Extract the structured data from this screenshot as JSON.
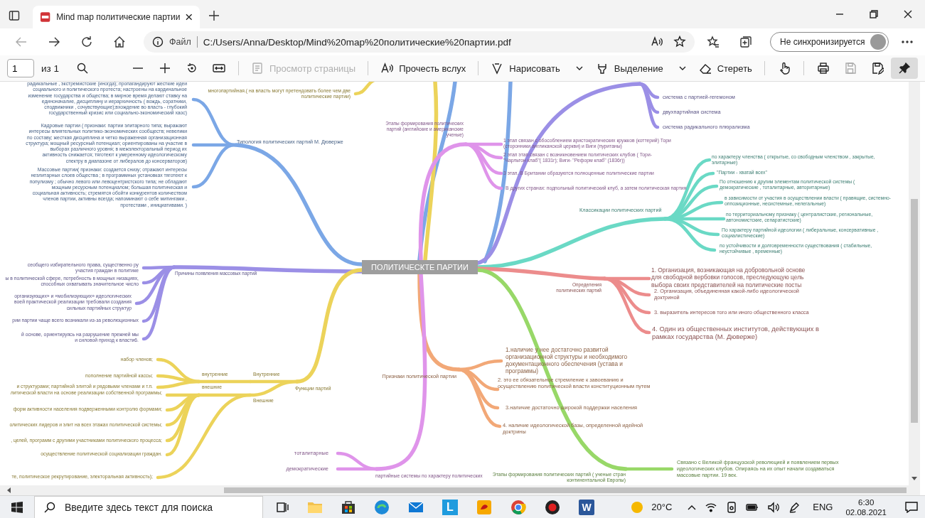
{
  "browser": {
    "tab": {
      "title": "Mind map политические партии",
      "selected": true
    },
    "address": {
      "scheme": "Файл",
      "url": "C:/Users/Anna/Desktop/Mind%20map%20политические%20партии.pdf"
    },
    "sync_button": "Не синхронизируется"
  },
  "pdf_toolbar": {
    "page": "1",
    "page_count": "из 1",
    "items": [
      {
        "label": "Просмотр страницы",
        "dropdown": false,
        "disabled": true
      },
      {
        "label": "Прочесть вслух",
        "dropdown": false,
        "disabled": false
      },
      {
        "label": "Нарисовать",
        "dropdown": true,
        "disabled": false
      },
      {
        "label": "Выделение",
        "dropdown": true,
        "disabled": false
      },
      {
        "label": "Стереть",
        "dropdown": false,
        "disabled": false
      }
    ],
    "pin": {
      "selected": true
    }
  },
  "mindmap": {
    "center": "ПОЛИТИЧЕСКТЕ ПАРТИИ",
    "branches": [
      {
        "label": "Типология политических партий М. Дюверже",
        "color": "#7ba7e6",
        "children": [
          {
            "text": "радикальные , экстремистские (иногда); пропагандируют жесткие идеи социального и политического протеста; настроены на кардинальное изменение государства и общества; в мирное время делают ставку на единоначалие, дисциплину и иерархичность ( вождь, соратники, сподвижники , сочувствующие);вхождение во власть - глубокий государственный кризис или социально-экономический хаос)"
          },
          {
            "text": "Кадровые партии ( признаки: партии элитарного типа; выражают интересы влиятельных политико-экономических сообществ; невелики по составу; жесткая дисциплина и четко выраженная организационная структура; мощный ресурсный потенциал; ориентированы на участие в выборах различного уровня; в межэлекторальный период их активность снижается; тяготеют к умеренному идеологическому спектру в диапазоне от либералов до консерваторов)"
          },
          {
            "text": "Массовые партии( признаки: создается снизу; отражают интересы неэлитарных слоев общества ; в программных установках тяготеют к популизму ; обычно левого или левоцентристского типа; не обладают мощным ресурсным потенциалом; большая политическая и социальная активность; стремятся обойти конкурентов количеством членов партии, активны всегда; напоминают о себе митингами , протестами , инициативами. )"
          }
        ]
      },
      {
        "color": "#ecd35a",
        "children": [
          {
            "text": "многопартийная.( на власть могут претендовать более чем две политические партии)"
          }
        ]
      },
      {
        "label": "Этапы формирования политических партий (английские и американские ученые)",
        "color": "#df94ea",
        "children": [
          {
            "text": "1 этап связан с обособлением аристократических кружков (коттерий) Тори (сторонники англиканской церкви) и Виги (пуританы)"
          },
          {
            "text": "2 этап этап связан с возникновением политических клубов ( Тори-\"Чарльтон клаб\"( 1831г); Виги- \"Реформ клаб\" (1836г))"
          },
          {
            "text": "3 этап. В Британии образуются полноценные политические партии"
          },
          {
            "text": "В других странах: подпольный политический клуб, а затем политическая партия"
          }
        ]
      },
      {
        "color": "#9b8fe6",
        "children": [
          {
            "text": "система с партией-гегемоном"
          },
          {
            "text": "двухпартийная система"
          },
          {
            "text": "система радикального плюрализма"
          }
        ]
      },
      {
        "label": "Классикации политических партий",
        "color": "#6ad9c5",
        "children": [
          {
            "text": "по характеру членства ( открытые, со свободным членством , закрытые, элитарные)"
          },
          {
            "text": "\"Партии - хватай всех\""
          },
          {
            "text": "По отношению к другим элементам политической системы ( демократические , тоталитарные, авторитарные)"
          },
          {
            "text": "в зависимости от участия в осуществлении власти ( правящие, системно-оппозиционные, несистемные, нелегальные)"
          },
          {
            "text": "по территориальному признаку ( централистские, региональные, автономистские, сепаратистские)"
          },
          {
            "text": "По характеру партийной идеологии ( либеральные, консервативные , социалистические)"
          },
          {
            "text": "по устойчивости и долговременности существования ( стабильные, неустойчивые , временные)"
          }
        ]
      },
      {
        "label": "Определения политических партий",
        "color": "#ec8c8c",
        "children": [
          {
            "text": "1.  Организация, возникающая на добровольной основе для свободной вербовки голосов, преследующую цель выбора своих представителей на политические посты"
          },
          {
            "text": "2.  Организация, объединенная какой-либо идеологической доктриной"
          },
          {
            "text": "3.  выразитель интересов того или иного общественного класса"
          },
          {
            "text": "4.  Один из общественных институтов, действующих в рамках государства (М. Дюверже)"
          }
        ]
      },
      {
        "label": "Этапы формирования политических партий ( ученые стран континентальной Европы)",
        "color": "#98d868",
        "children": [
          {
            "text": "Связано с Великой французской революцией и появлением первых идеологических клубов. Опираясь на их опыт начали создаваться массовые партии. 19 век."
          }
        ]
      },
      {
        "label": "Признаки политической партии",
        "color": "#f2a877",
        "children": [
          {
            "text": "1.наличие у нее достаточно развитой организационной структуры и необходимого документационного обеспечения (устава и программы)"
          },
          {
            "text": "2.  это ее обязательное стремление к завоеванию и осуществлению политической власти конституционным путем"
          },
          {
            "text": "3.наличие достаточно широкой поддержки населения"
          },
          {
            "text": "4.  наличие идеологической базы, определенной идейной доктрины"
          }
        ]
      },
      {
        "label": "Причины появления массовых партий",
        "color": "#9b8fe6",
        "children": [
          {
            "text": "сеобщего избирательного права, существенно ру участия граждан в политике"
          },
          {
            "text": "ы в политической сфере, потребность в мощных низациях, способных охватывать значительное число"
          },
          {
            "text": "организующих» и «мобилизующих» идеологических воей практической реализации требовали создания сильных партийных структур"
          },
          {
            "text": "рии партии чаще всего возникали из-за революционных"
          },
          {
            "text": "й основе, ориентируясь на разрушение прежней мы и силовой приход к власти6."
          }
        ]
      },
      {
        "label": "Функции партий",
        "color": "#ecd35a",
        "children": [
          {
            "text": "Внутренние",
            "children": [
              {
                "text": "внутренние",
                "children": [
                  {
                    "text": "набор членов;"
                  },
                  {
                    "text": "пополнение партийной кассы;"
                  },
                  {
                    "text": "и структурами; партийной элитой и рядовыми членами и т.п."
                  }
                ]
              }
            ]
          },
          {
            "text": "Внешние",
            "children": [
              {
                "text": "внешние",
                "children": [
                  {
                    "text": "литической власти на основе реализации собственной программы;"
                  },
                  {
                    "text": "форм активности населения подверженными контролю формами;"
                  },
                  {
                    "text": "олитических лидеров и элит на всех этажах политической системы;"
                  },
                  {
                    "text": ", целей, программ с другими участниками политического процесса;"
                  },
                  {
                    "text": "осуществление политической социализации граждан."
                  }
                ]
              },
              {
                "text": "те, политическое рекрутирование, электоральная активность);"
              }
            ]
          }
        ]
      },
      {
        "label": "партийные системы по характеру политических",
        "color": "#df94ea",
        "children": [
          {
            "text": "тоталитарные"
          },
          {
            "text": "демократические"
          }
        ]
      }
    ]
  },
  "taskbar": {
    "search_placeholder": "Введите здесь текст для поиска",
    "apps": [
      {
        "kind": "taskview"
      },
      {
        "kind": "folder"
      },
      {
        "kind": "store"
      },
      {
        "kind": "edge"
      },
      {
        "kind": "mail"
      },
      {
        "kind": "tile",
        "glyph": "L"
      },
      {
        "kind": "app"
      },
      {
        "kind": "chrome"
      },
      {
        "kind": "record"
      },
      {
        "kind": "word",
        "glyph": "W"
      }
    ],
    "weather": "20°C",
    "language": "ENG",
    "time": "6:30",
    "date": "02.08.2021"
  }
}
